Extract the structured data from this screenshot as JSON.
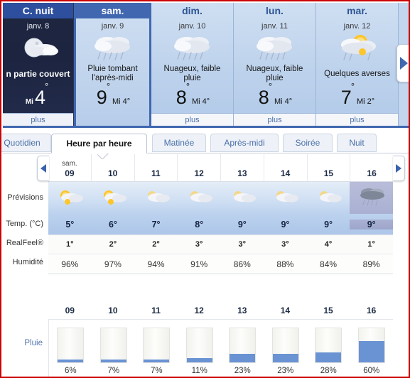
{
  "daily": {
    "nav_arrow_icon": "chevron-right-icon",
    "days": [
      {
        "name": "C. nuit",
        "date": "janv. 8",
        "icon": "moon-partly-cloudy-icon",
        "desc": "n partie couvert",
        "pre": "Mi",
        "hi": "4",
        "deg": "°",
        "lo": "",
        "more": "plus",
        "variant": "night"
      },
      {
        "name": "sam.",
        "date": "janv. 9",
        "icon": "rain-cloud-icon",
        "desc": "Pluie tombant l'après-midi",
        "pre": "",
        "hi": "9",
        "deg": "°",
        "lo": "Mi 4°",
        "more": "",
        "variant": "selected"
      },
      {
        "name": "dim.",
        "date": "janv. 10",
        "icon": "rain-cloud-icon",
        "desc": "Nuageux, faible pluie",
        "pre": "",
        "hi": "8",
        "deg": "°",
        "lo": "Mi 4°",
        "more": "plus",
        "variant": "normal"
      },
      {
        "name": "lun.",
        "date": "janv. 11",
        "icon": "rain-cloud-icon",
        "desc": "Nuageux, faible pluie",
        "pre": "",
        "hi": "8",
        "deg": "°",
        "lo": "Mi 4°",
        "more": "plus",
        "variant": "normal"
      },
      {
        "name": "mar.",
        "date": "janv. 12",
        "icon": "sun-rain-shower-icon",
        "desc": "Quelques averses",
        "pre": "",
        "hi": "7",
        "deg": "°",
        "lo": "Mi 2°",
        "more": "plus",
        "variant": "normal"
      }
    ]
  },
  "tabs": [
    {
      "label": "Quotidien",
      "active": false
    },
    {
      "label": "Heure par heure",
      "active": true
    },
    {
      "label": "Matinée",
      "active": false
    },
    {
      "label": "Après-midi",
      "active": false
    },
    {
      "label": "Soirée",
      "active": false
    },
    {
      "label": "Nuit",
      "active": false
    }
  ],
  "hourly": {
    "day_tag": "sam.",
    "prev_arrow_icon": "chevron-left-icon",
    "next_arrow_icon": "chevron-right-icon",
    "hours": [
      "09",
      "10",
      "11",
      "12",
      "13",
      "14",
      "15",
      "16"
    ],
    "row_labels": {
      "forecast": "Prévisions",
      "temp": "Temp. (°C)",
      "realfeel": "RealFeel®",
      "humidity": "Humidité"
    },
    "icons": [
      "sun-cloud-icon",
      "sun-cloud-icon",
      "sun-cloud-icon",
      "sun-cloud-icon",
      "sun-cloud-icon",
      "sun-cloud-icon",
      "sun-cloud-icon",
      "rain-cloud-icon"
    ],
    "temp": [
      "5°",
      "6°",
      "7°",
      "8°",
      "9°",
      "9°",
      "9°",
      "9°"
    ],
    "realfeel": [
      "1°",
      "2°",
      "2°",
      "3°",
      "3°",
      "3°",
      "4°",
      "1°"
    ],
    "humidity": [
      "96%",
      "97%",
      "94%",
      "91%",
      "86%",
      "88%",
      "84%",
      "89%"
    ],
    "highlight_index": 7
  },
  "chart_data": {
    "type": "bar",
    "title": "",
    "xlabel": "",
    "ylabel": "Pluie",
    "categories": [
      "09",
      "10",
      "11",
      "12",
      "13",
      "14",
      "15",
      "16"
    ],
    "values": [
      6,
      7,
      7,
      11,
      23,
      23,
      28,
      60
    ],
    "labels": [
      "6%",
      "7%",
      "7%",
      "11%",
      "23%",
      "23%",
      "28%",
      "60%"
    ],
    "ylim": [
      0,
      100
    ],
    "grid": false,
    "legend": "none",
    "bar_color": "#6a93d4",
    "track_color": "#fbfbf8"
  },
  "colors": {
    "accent_blue": "#4067b0",
    "header_blue": "#2d5494",
    "night_panel": "#20263f",
    "rain_bar": "#6a93d4",
    "frame_red": "#cc0000"
  }
}
